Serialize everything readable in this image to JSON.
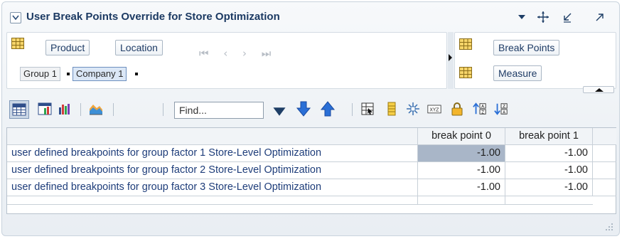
{
  "header": {
    "title": "User Break Points Override for Store Optimization"
  },
  "edges": {
    "row_dims": [
      "Product",
      "Location"
    ],
    "col_dims": [
      "Break Points",
      "Measure"
    ],
    "page_chips": [
      "Group 1",
      "Company 1"
    ],
    "nav_arrows": "⏮ ‹ › ⏭"
  },
  "toolbar": {
    "find_placeholder": "Find..."
  },
  "table": {
    "columns": [
      "break point 0",
      "break point 1"
    ],
    "rows": [
      {
        "label": "user defined breakpoints for group factor 1 Store-Level Optimization",
        "values": [
          "-1.00",
          "-1.00"
        ]
      },
      {
        "label": "user defined breakpoints for group factor 2 Store-Level Optimization",
        "values": [
          "-1.00",
          "-1.00"
        ]
      },
      {
        "label": "user defined breakpoints for group factor 3 Store-Level Optimization",
        "values": [
          "-1.00",
          "-1.00"
        ]
      }
    ]
  },
  "colors": {
    "title": "#1c3a63",
    "selected_cell": "#a9b6c8",
    "arrow_blue": "#2a6fd6"
  }
}
